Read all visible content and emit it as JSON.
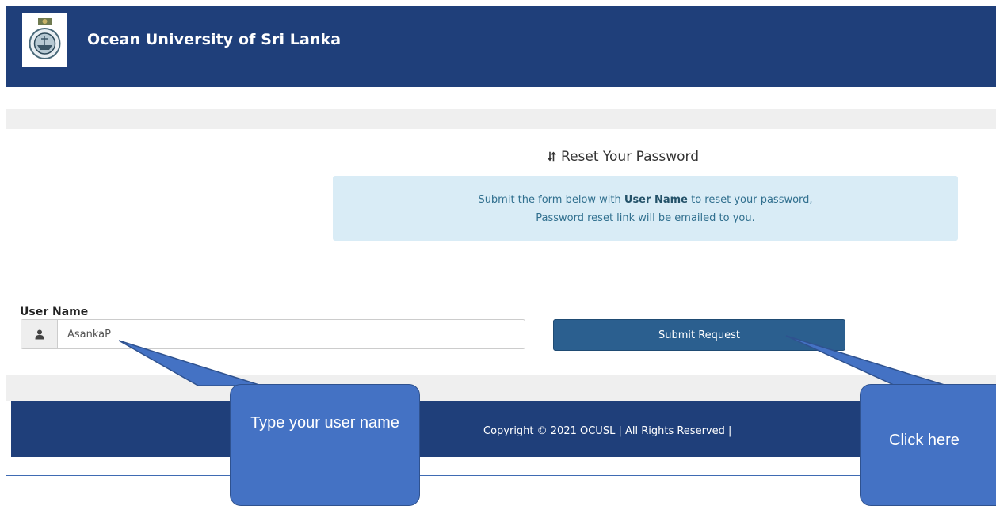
{
  "header": {
    "title": "Ocean University of Sri Lanka"
  },
  "reset": {
    "icon": "retweet-icon",
    "title": "Reset Your Password"
  },
  "info": {
    "line1_prefix": "Submit the form below with ",
    "line1_bold": "User Name",
    "line1_suffix": " to reset your password,",
    "line2": "Password reset link will be emailed to you."
  },
  "form": {
    "user_label": "User Name",
    "user_value": "AsankaP",
    "user_icon": "user-icon",
    "submit_label": "Submit Request"
  },
  "footer": {
    "copyright": "Copyright © 2021 OCUSL | All Rights Reserved |"
  },
  "callouts": {
    "left": "Type your user name",
    "right": "Click here"
  },
  "colors": {
    "header_bg": "#1f3f7a",
    "button_bg": "#2b5f8f",
    "info_bg": "#d9ecf6",
    "callout_bg": "#4472c4"
  }
}
